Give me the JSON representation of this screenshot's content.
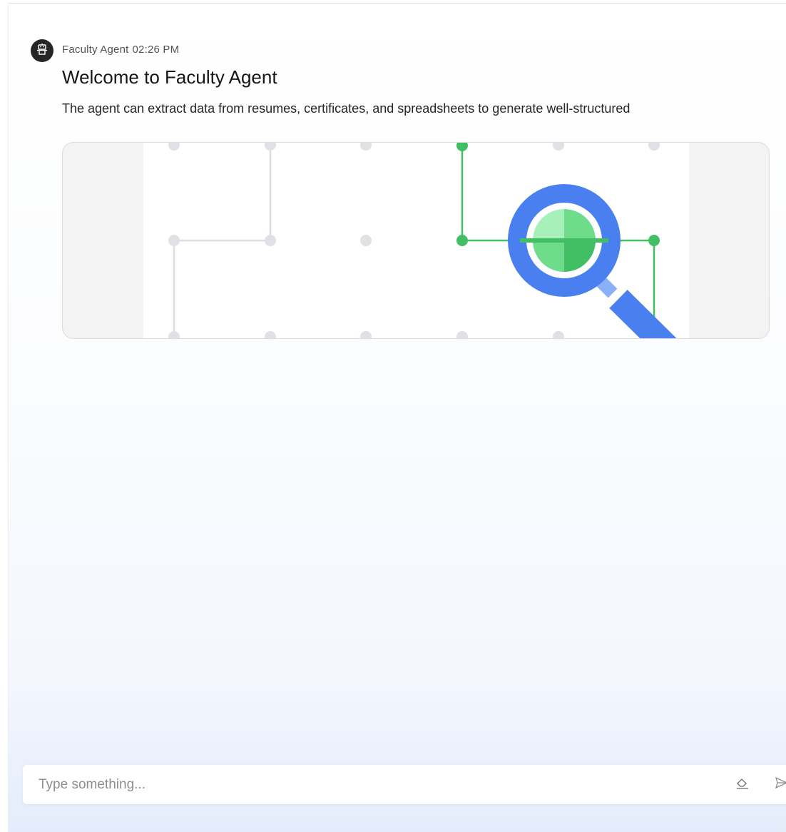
{
  "message": {
    "sender": "Faculty Agent",
    "time": "02:26 PM",
    "title": "Welcome to Faculty Agent",
    "body": "The agent can extract data from resumes, certificates, and spreadsheets to generate well-structured",
    "avatar_icon": "robot-icon",
    "illustration_icon": "magnifying-glass-network-icon"
  },
  "composer": {
    "placeholder": "Type something...",
    "value": "",
    "clear_icon": "eraser-icon",
    "send_icon": "send-icon"
  },
  "colors": {
    "avatar_bg": "#262626",
    "accent_blue": "#4a7ff0",
    "accent_green": "#42be65",
    "grid_dot": "#e0e0e6"
  }
}
